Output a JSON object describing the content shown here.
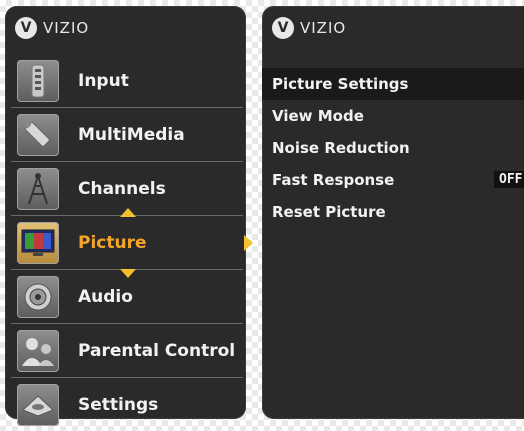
{
  "left_panel": {
    "logo_text": "VIZIO",
    "items": [
      {
        "label": "Input"
      },
      {
        "label": "MultiMedia"
      },
      {
        "label": "Channels"
      },
      {
        "label": "Picture",
        "selected": true
      },
      {
        "label": "Audio"
      },
      {
        "label": "Parental Control"
      },
      {
        "label": "Settings"
      }
    ]
  },
  "right_panel": {
    "logo_text": "VIZIO",
    "items": [
      {
        "label": "Picture Settings"
      },
      {
        "label": "View Mode"
      },
      {
        "label": "Noise Reduction"
      },
      {
        "label": "Fast Response",
        "value": "OFF"
      },
      {
        "label": "Reset Picture"
      }
    ]
  },
  "colors": {
    "panel_bg": "#2a2a2a",
    "highlight_text": "#f3a52a",
    "arrow": "#f2bf2f",
    "text": "#f2f2f2"
  }
}
